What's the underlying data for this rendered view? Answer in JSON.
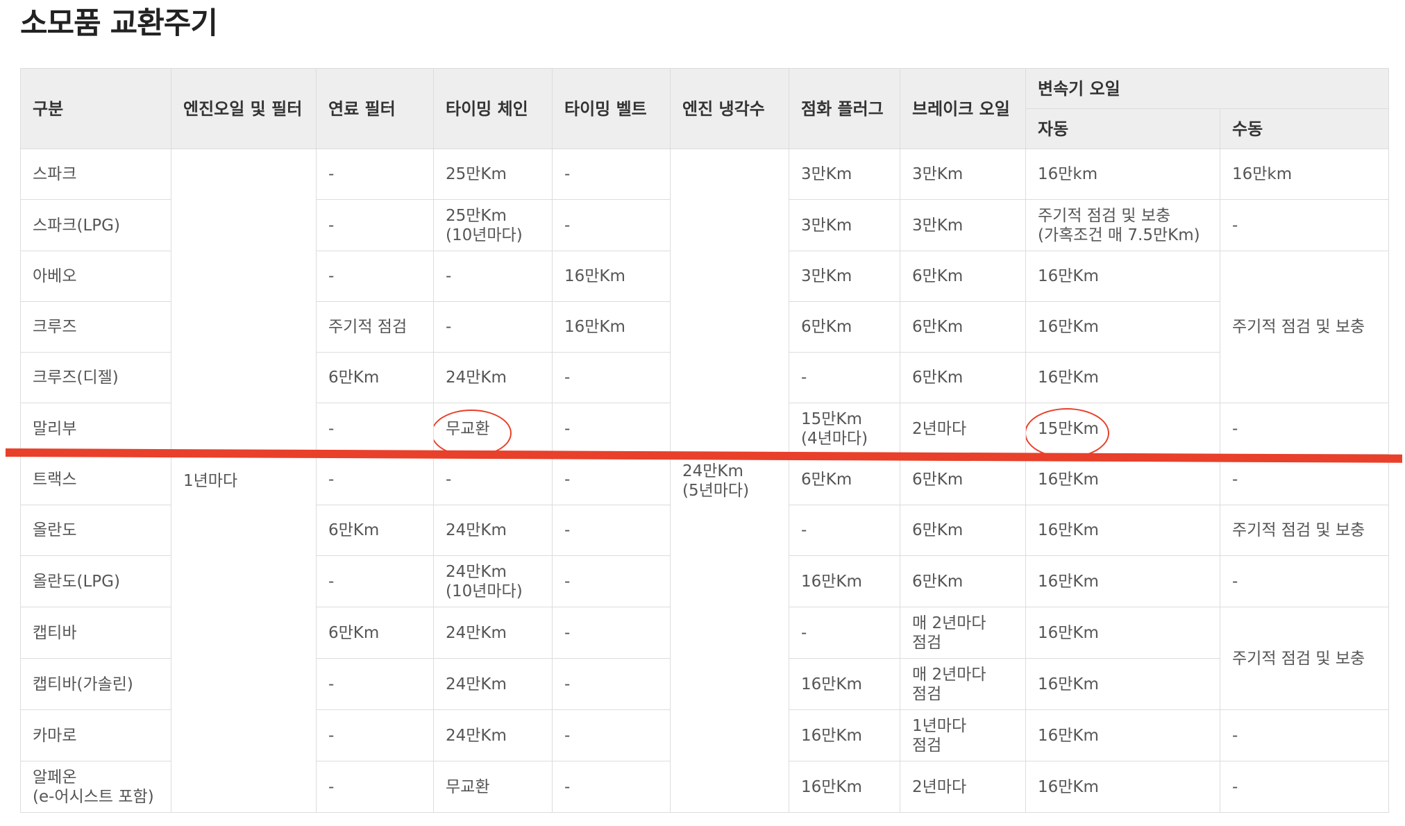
{
  "page": {
    "title": "소모품 교환주기"
  },
  "table": {
    "headers": {
      "category": "구분",
      "engine_oil": "엔진오일 및 필터",
      "fuel_filter": "연료 필터",
      "timing_chain": "타이밍 체인",
      "timing_belt": "타이밍 벨트",
      "coolant": "엔진 냉각수",
      "spark_plug": "점화 플러그",
      "brake_oil": "브레이크 오일",
      "transmission": "변속기 오일",
      "auto": "자동",
      "manual": "수동"
    },
    "merged": {
      "engine_oil_all": "1년마다",
      "coolant_all": "24만Km\n(5년마다)",
      "manual_aveo_to_cruze_diesel": "주기적 점검 및 보충",
      "manual_captiva_group": "주기적 점검 및 보충"
    },
    "rows": [
      {
        "name": "스파크",
        "fuel": "-",
        "chain": "25만Km",
        "belt": "-",
        "plug": "3만Km",
        "brake": "3만Km",
        "auto": "16만km",
        "manual": "16만km"
      },
      {
        "name": "스파크(LPG)",
        "fuel": "-",
        "chain": "25만Km\n(10년마다)",
        "belt": "-",
        "plug": "3만Km",
        "brake": "3만Km",
        "auto": "주기적 점검 및 보충\n(가혹조건 매 7.5만Km)",
        "manual": "-"
      },
      {
        "name": "아베오",
        "fuel": "-",
        "chain": "-",
        "belt": "16만Km",
        "plug": "3만Km",
        "brake": "6만Km",
        "auto": "16만Km"
      },
      {
        "name": "크루즈",
        "fuel": "주기적 점검",
        "chain": "-",
        "belt": "16만Km",
        "plug": "6만Km",
        "brake": "6만Km",
        "auto": "16만Km"
      },
      {
        "name": "크루즈(디젤)",
        "fuel": "6만Km",
        "chain": "24만Km",
        "belt": "-",
        "plug": "-",
        "brake": "6만Km",
        "auto": "16만Km"
      },
      {
        "name": "말리부",
        "fuel": "-",
        "chain": "무교환",
        "belt": "-",
        "plug": "15만Km\n(4년마다)",
        "brake": "2년마다",
        "auto": "15만Km",
        "manual": "-"
      },
      {
        "name": "트랙스",
        "fuel": "-",
        "chain": "-",
        "belt": "-",
        "plug": "6만Km",
        "brake": "6만Km",
        "auto": "16만Km",
        "manual": "-"
      },
      {
        "name": "올란도",
        "fuel": "6만Km",
        "chain": "24만Km",
        "belt": "-",
        "plug": "-",
        "brake": "6만Km",
        "auto": "16만Km",
        "manual": "주기적 점검 및 보충"
      },
      {
        "name": "올란도(LPG)",
        "fuel": "-",
        "chain": "24만Km\n(10년마다)",
        "belt": "-",
        "plug": "16만Km",
        "brake": "6만Km",
        "auto": "16만Km",
        "manual": "-"
      },
      {
        "name": "캡티바",
        "fuel": "6만Km",
        "chain": "24만Km",
        "belt": "-",
        "plug": "-",
        "brake": "매 2년마다\n점검",
        "auto": "16만Km"
      },
      {
        "name": "캡티바(가솔린)",
        "fuel": "-",
        "chain": "24만Km",
        "belt": "-",
        "plug": "16만Km",
        "brake": "매 2년마다\n점검",
        "auto": "16만Km"
      },
      {
        "name": "카마로",
        "fuel": "-",
        "chain": "24만Km",
        "belt": "-",
        "plug": "16만Km",
        "brake": "1년마다\n점검",
        "auto": "16만Km",
        "manual": "-"
      },
      {
        "name": "알페온\n(e-어시스트 포함)",
        "fuel": "-",
        "chain": "무교환",
        "belt": "-",
        "plug": "16만Km",
        "brake": "2년마다",
        "auto": "16만Km",
        "manual": "-"
      }
    ]
  },
  "annotations": {
    "color": "#e8402a"
  }
}
